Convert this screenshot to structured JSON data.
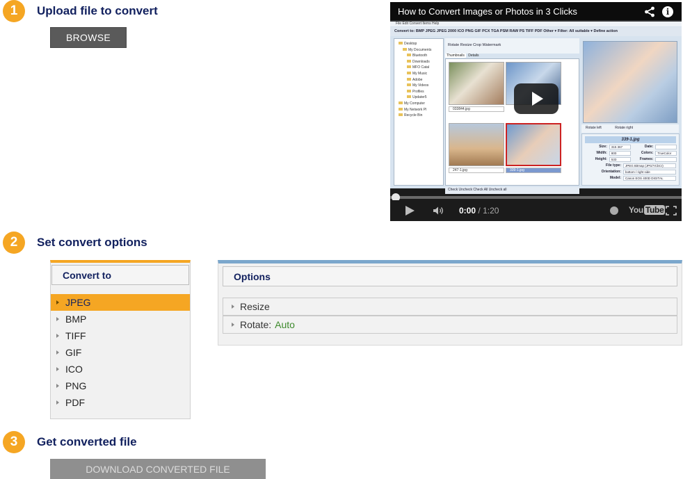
{
  "steps": [
    {
      "number": "1",
      "title": "Upload file to convert"
    },
    {
      "number": "2",
      "title": "Set convert options"
    },
    {
      "number": "3",
      "title": "Get converted file"
    }
  ],
  "browse_label": "BROWSE",
  "download_label": "DOWNLOAD CONVERTED FILE",
  "convert_panel": {
    "heading": "Convert to",
    "formats": [
      "JPEG",
      "BMP",
      "TIFF",
      "GIF",
      "ICO",
      "PNG",
      "PDF"
    ],
    "selected": "JPEG"
  },
  "options_panel": {
    "heading": "Options",
    "resize_label": "Resize",
    "rotate_label": "Rotate:",
    "rotate_value": "Auto"
  },
  "video": {
    "title": "How to Convert Images or Photos in 3 Clicks",
    "current_time": "0:00",
    "separator": "/",
    "duration": "1:20",
    "yt_you": "You",
    "yt_tube": "Tube",
    "progress": 0.0,
    "app": {
      "menu": "File   Edit   Convert   Items   Help",
      "convert_bar": "Convert to:   BMP  JPEG  JPEG 2000  ICO  PNG  GIF  PCX  TGA  PSM  RAW  PS  TIFF  PDF  Other ▾   Filter:  All suitable ▾   Define action",
      "tree": [
        "Desktop",
        "My Documents",
        "Bluetooth",
        "Downloads",
        "MFO Catal",
        "My Music",
        "Adobe",
        "My Videos",
        "Profiles",
        "Updater5",
        "My Computer",
        "My Network Pl",
        "Recycle Bin"
      ],
      "toolbar": "Rotate     Resize     Crop     Watermark",
      "tab_thumbnails": "Thumbnails",
      "tab_details": "Details",
      "thumbs": [
        "033844.jpg",
        "",
        "247-1.jpg",
        "339-1.jpg"
      ],
      "bottom_bar": "Check   Uncheck     Check All    Uncheck all",
      "rotate_left": "Rotate left",
      "rotate_right": "Rotate right",
      "file_name": "339-1.jpg",
      "props": [
        {
          "k": "Size:",
          "v": "315 367",
          "k2": "Date:",
          "v2": ""
        },
        {
          "k": "Width:",
          "v": "800",
          "k2": "Colors:",
          "v2": "TrueColor"
        },
        {
          "k": "Height:",
          "v": "533",
          "k2": "Frames:",
          "v2": ""
        }
      ],
      "props_long": [
        {
          "k": "File type:",
          "v": "JPEG Bitmap (JPG/YCbCr)"
        },
        {
          "k": "Orientation:",
          "v": "bottom / right side"
        },
        {
          "k": "Model:",
          "v": "Canon EOS 400D DIGITAL"
        }
      ]
    }
  },
  "colors": {
    "accent_orange": "#f5a623",
    "title_navy": "#11205e",
    "options_blue": "#7ba7cc",
    "auto_green": "#3d8a2c"
  }
}
